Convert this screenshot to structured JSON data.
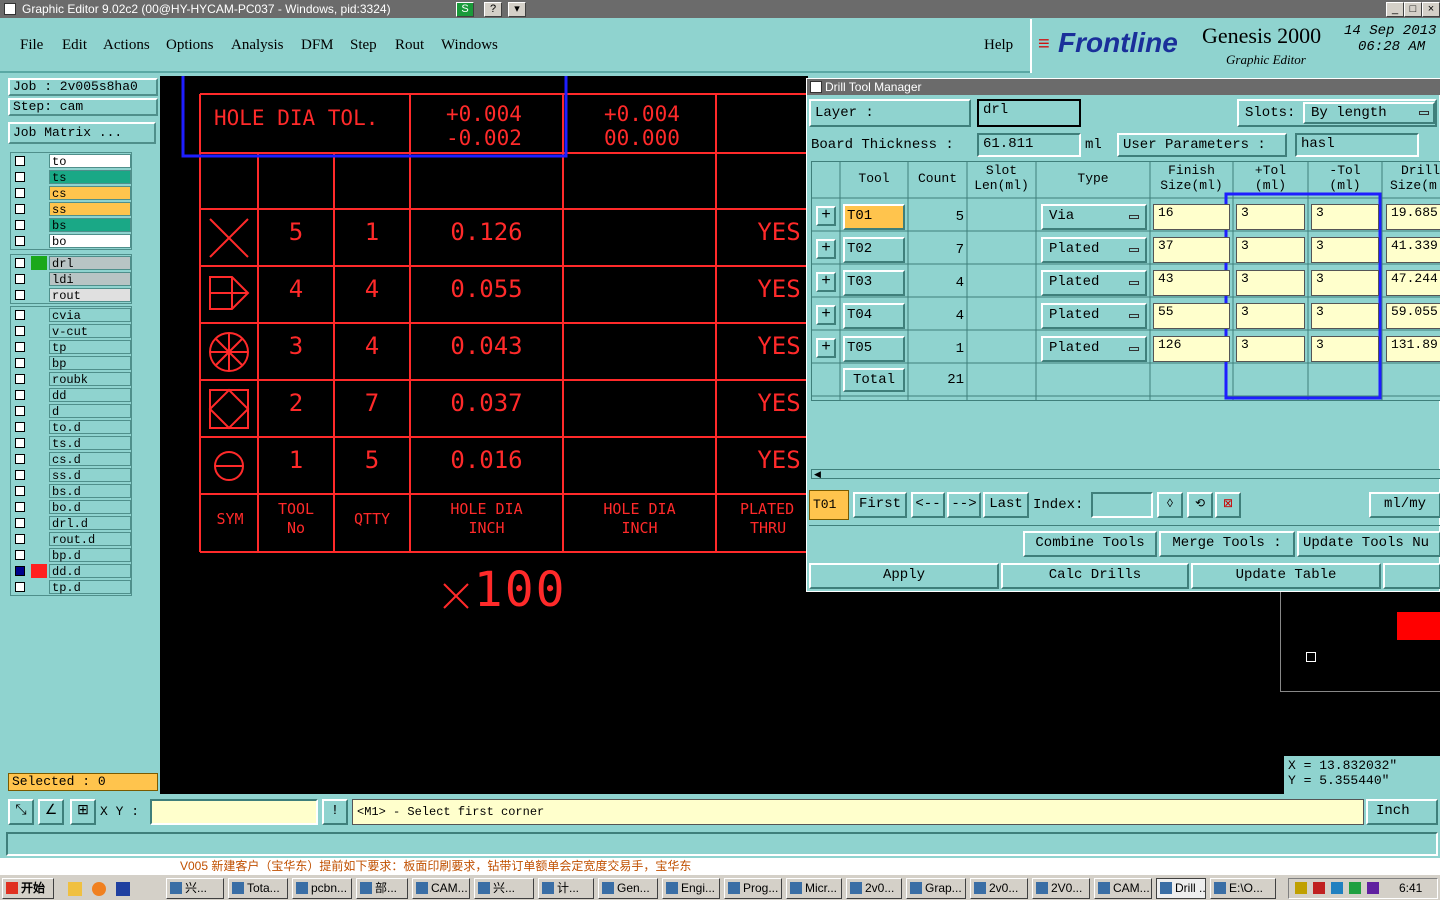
{
  "window": {
    "title": "Graphic Editor 9.02c2 (00@HY-HYCAM-PC037 - Windows, pid:3324)"
  },
  "menu": {
    "items": [
      "File",
      "Edit",
      "Actions",
      "Options",
      "Analysis",
      "DFM",
      "Step",
      "Rout",
      "Windows"
    ],
    "help": "Help"
  },
  "brand": {
    "logo": "Frontline",
    "product": "Genesis 2000",
    "subtitle": "Graphic Editor",
    "date": "14 Sep 2013",
    "time": "06:28 AM"
  },
  "left": {
    "job": "Job : 2v005s8ha0",
    "step": "Step: cam",
    "job_matrix": "Job Matrix ...",
    "selected": "Selected : 0",
    "layers_group1": [
      {
        "name": "to",
        "color": "#ffffff"
      },
      {
        "name": "ts",
        "color": "#1aa886"
      },
      {
        "name": "cs",
        "color": "#ffc44d"
      },
      {
        "name": "ss",
        "color": "#ffc44d"
      },
      {
        "name": "bs",
        "color": "#1aa886"
      },
      {
        "name": "bo",
        "color": "#ffffff"
      }
    ],
    "layers_group2": [
      {
        "name": "drl",
        "color": "#b8c4c4"
      },
      {
        "name": "ldi",
        "color": "#b8c4c4"
      },
      {
        "name": "rout",
        "color": "#e0e0e0"
      }
    ],
    "layers_group3": [
      "cvia",
      "v-cut",
      "tp",
      "bp",
      "roubk",
      "dd",
      "d",
      "to.d",
      "ts.d",
      "cs.d",
      "ss.d",
      "bs.d",
      "bo.d",
      "drl.d",
      "rout.d",
      "bp.d",
      "dd.d",
      "tp.d"
    ]
  },
  "drawing": {
    "header_label": "HOLE DIA TOL.",
    "tol1_plus": "+0.004",
    "tol1_minus": "-0.002",
    "tol2_plus": "+0.004",
    "tol2_minus": "00.000",
    "rows": [
      {
        "tool": "5",
        "qty": "1",
        "dia": "0.126",
        "plated": "YES"
      },
      {
        "tool": "4",
        "qty": "4",
        "dia": "0.055",
        "plated": "YES"
      },
      {
        "tool": "3",
        "qty": "4",
        "dia": "0.043",
        "plated": "YES"
      },
      {
        "tool": "2",
        "qty": "7",
        "dia": "0.037",
        "plated": "YES"
      },
      {
        "tool": "1",
        "qty": "5",
        "dia": "0.016",
        "plated": "YES"
      }
    ],
    "footer": {
      "sym": "SYM",
      "tool_l1": "TOOL",
      "tool_l2": "No",
      "qty": "QTTY",
      "dia1_l1": "HOLE DIA",
      "dia1_l2": "INCH",
      "dia2_l1": "HOLE DIA",
      "dia2_l2": "INCH",
      "plated_l1": "PLATED",
      "plated_l2": "THRU"
    },
    "scale": "x100"
  },
  "dtm": {
    "title": "Drill Tool Manager",
    "layer_label": "Layer :",
    "layer_value": "drl",
    "slots_label": "Slots:",
    "slots_value": "By length",
    "board_label": "Board Thickness :",
    "board_value": "61.811",
    "board_unit": "ml",
    "user_params": "User Parameters :",
    "user_params_value": "hasl",
    "columns": {
      "tool": "Tool",
      "count": "Count",
      "slot1": "Slot",
      "slot2": "Len(ml)",
      "type": "Type",
      "finish1": "Finish",
      "finish2": "Size(ml)",
      "ptol1": "+Tol",
      "ptol2": "(ml)",
      "mtol1": "-Tol",
      "mtol2": "(ml)",
      "drill1": "Drill",
      "drill2": "Size(m"
    },
    "rows": [
      {
        "tool": "T01",
        "count": "5",
        "type": "Via",
        "finish": "16",
        "ptol": "3",
        "mtol": "3",
        "drill": "19.685"
      },
      {
        "tool": "T02",
        "count": "7",
        "type": "Plated",
        "finish": "37",
        "ptol": "3",
        "mtol": "3",
        "drill": "41.339"
      },
      {
        "tool": "T03",
        "count": "4",
        "type": "Plated",
        "finish": "43",
        "ptol": "3",
        "mtol": "3",
        "drill": "47.244"
      },
      {
        "tool": "T04",
        "count": "4",
        "type": "Plated",
        "finish": "55",
        "ptol": "3",
        "mtol": "3",
        "drill": "59.055"
      },
      {
        "tool": "T05",
        "count": "1",
        "type": "Plated",
        "finish": "126",
        "ptol": "3",
        "mtol": "3",
        "drill": "131.89"
      }
    ],
    "total_label": "Total",
    "total_value": "21",
    "nav": {
      "current": "T01",
      "first": "First",
      "prev": "<--",
      "next": "-->",
      "last": "Last",
      "index_label": "Index:",
      "units": "ml/my"
    },
    "combine": "Combine Tools",
    "merge": "Merge Tools :",
    "update_num": "Update Tools Nu",
    "apply": "Apply",
    "calc": "Calc Drills",
    "update_table": "Update Table"
  },
  "coords": {
    "x": "X = 13.832032\"",
    "y": "Y = 5.355440\""
  },
  "status": {
    "xy_label": "X Y :",
    "prompt": "<M1> - Select first corner",
    "units": "Inch",
    "bg_text": "V005 新建客户（宝华东）提前如下要求：板面印刷要求，钻带订单额单会定宽度交易手，宝华东"
  },
  "taskbar": {
    "start": "开始",
    "tasks": [
      "兴...",
      "Tota...",
      "pcbn...",
      "部...",
      "CAM...",
      "兴...",
      "计...",
      "Gen...",
      "Engi...",
      "Prog...",
      "Micr...",
      "2v0...",
      "Grap...",
      "2v0...",
      "2V0...",
      "CAM...",
      "Drill ...",
      "E:\\O..."
    ],
    "clock": "6:41"
  }
}
